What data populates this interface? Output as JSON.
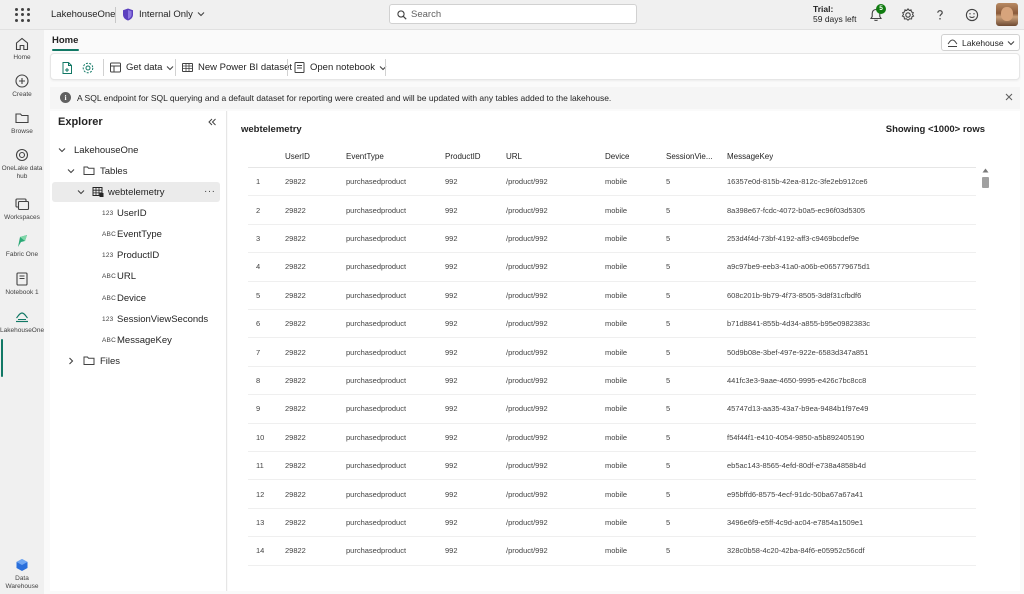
{
  "topbar": {
    "workspace": "LakehouseOne",
    "sensitivity": "Internal Only",
    "search_placeholder": "Search",
    "trial_line1": "Trial:",
    "trial_line2": "59 days left",
    "notification_count": "5"
  },
  "leftnav": {
    "items": [
      {
        "label": "Home",
        "icon": "home-icon"
      },
      {
        "label": "Create",
        "icon": "plus-circle-icon"
      },
      {
        "label": "Browse",
        "icon": "folder-icon"
      },
      {
        "label": "OneLake data hub",
        "icon": "onelake-icon"
      },
      {
        "label": "Workspaces",
        "icon": "workspaces-icon"
      },
      {
        "label": "Fabric One",
        "icon": "fabric-icon"
      },
      {
        "label": "Notebook 1",
        "icon": "notebook-icon"
      },
      {
        "label": "LakehouseOne",
        "icon": "lakehouse-icon"
      },
      {
        "label": "Data Warehouse",
        "icon": "data-warehouse-icon"
      }
    ]
  },
  "tabs": {
    "home": "Home"
  },
  "item_switcher": "Lakehouse",
  "ribbon": {
    "get_data": "Get data",
    "new_dataset": "New Power BI dataset",
    "open_notebook": "Open notebook"
  },
  "banner": {
    "message": "A SQL endpoint for SQL querying and a default dataset for reporting were created and will be updated with any tables added to the lakehouse."
  },
  "explorer": {
    "title": "Explorer",
    "lakehouse": "LakehouseOne",
    "tables": "Tables",
    "table": "webtelemetry",
    "columns": [
      {
        "type": "123",
        "name": "UserID"
      },
      {
        "type": "ABC",
        "name": "EventType"
      },
      {
        "type": "123",
        "name": "ProductID"
      },
      {
        "type": "ABC",
        "name": "URL"
      },
      {
        "type": "ABC",
        "name": "Device"
      },
      {
        "type": "123",
        "name": "SessionViewSeconds"
      },
      {
        "type": "ABC",
        "name": "MessageKey"
      }
    ],
    "files": "Files"
  },
  "preview": {
    "title": "webtelemetry",
    "row_info": "Showing <1000> rows",
    "headers": [
      "UserID",
      "EventType",
      "ProductID",
      "URL",
      "Device",
      "SessionVie...",
      "MessageKey"
    ],
    "rows": [
      [
        "1",
        "29822",
        "purchasedproduct",
        "992",
        "/product/992",
        "mobile",
        "5",
        "16357e0d-815b-42ea-812c-3fe2eb912ce6"
      ],
      [
        "2",
        "29822",
        "purchasedproduct",
        "992",
        "/product/992",
        "mobile",
        "5",
        "8a398e67-fcdc-4072-b0a5-ec96f03d5305"
      ],
      [
        "3",
        "29822",
        "purchasedproduct",
        "992",
        "/product/992",
        "mobile",
        "5",
        "253d4f4d-73bf-4192-aff3-c9469bcdef9e"
      ],
      [
        "4",
        "29822",
        "purchasedproduct",
        "992",
        "/product/992",
        "mobile",
        "5",
        "a9c97be9-eeb3-41a0-a06b-e065779675d1"
      ],
      [
        "5",
        "29822",
        "purchasedproduct",
        "992",
        "/product/992",
        "mobile",
        "5",
        "608c201b-9b79-4f73-8505-3d8f31cfbdf6"
      ],
      [
        "6",
        "29822",
        "purchasedproduct",
        "992",
        "/product/992",
        "mobile",
        "5",
        "b71d8841-855b-4d34-a855-b95e0982383c"
      ],
      [
        "7",
        "29822",
        "purchasedproduct",
        "992",
        "/product/992",
        "mobile",
        "5",
        "50d9b08e-3bef-497e-922e-6583d347a851"
      ],
      [
        "8",
        "29822",
        "purchasedproduct",
        "992",
        "/product/992",
        "mobile",
        "5",
        "441fc3e3-9aae-4650-9995-e426c7bc8cc8"
      ],
      [
        "9",
        "29822",
        "purchasedproduct",
        "992",
        "/product/992",
        "mobile",
        "5",
        "45747d13-aa35-43a7-b9ea-9484b1f97e49"
      ],
      [
        "10",
        "29822",
        "purchasedproduct",
        "992",
        "/product/992",
        "mobile",
        "5",
        "f54f44f1-e410-4054-9850-a5b892405190"
      ],
      [
        "11",
        "29822",
        "purchasedproduct",
        "992",
        "/product/992",
        "mobile",
        "5",
        "eb5ac143-8565-4efd-80df-e738a4858b4d"
      ],
      [
        "12",
        "29822",
        "purchasedproduct",
        "992",
        "/product/992",
        "mobile",
        "5",
        "e95bffd6-8575-4ecf-91dc-50ba67a67a41"
      ],
      [
        "13",
        "29822",
        "purchasedproduct",
        "992",
        "/product/992",
        "mobile",
        "5",
        "3496e6f9-e5ff-4c9d-ac04-e7854a1509e1"
      ],
      [
        "14",
        "29822",
        "purchasedproduct",
        "992",
        "/product/992",
        "mobile",
        "5",
        "328c0b58-4c20-42ba-84f6-e05952c56cdf"
      ]
    ]
  },
  "colors": {
    "accent": "#117865",
    "shield": "#5b3fbf",
    "badge": "#107c10"
  }
}
